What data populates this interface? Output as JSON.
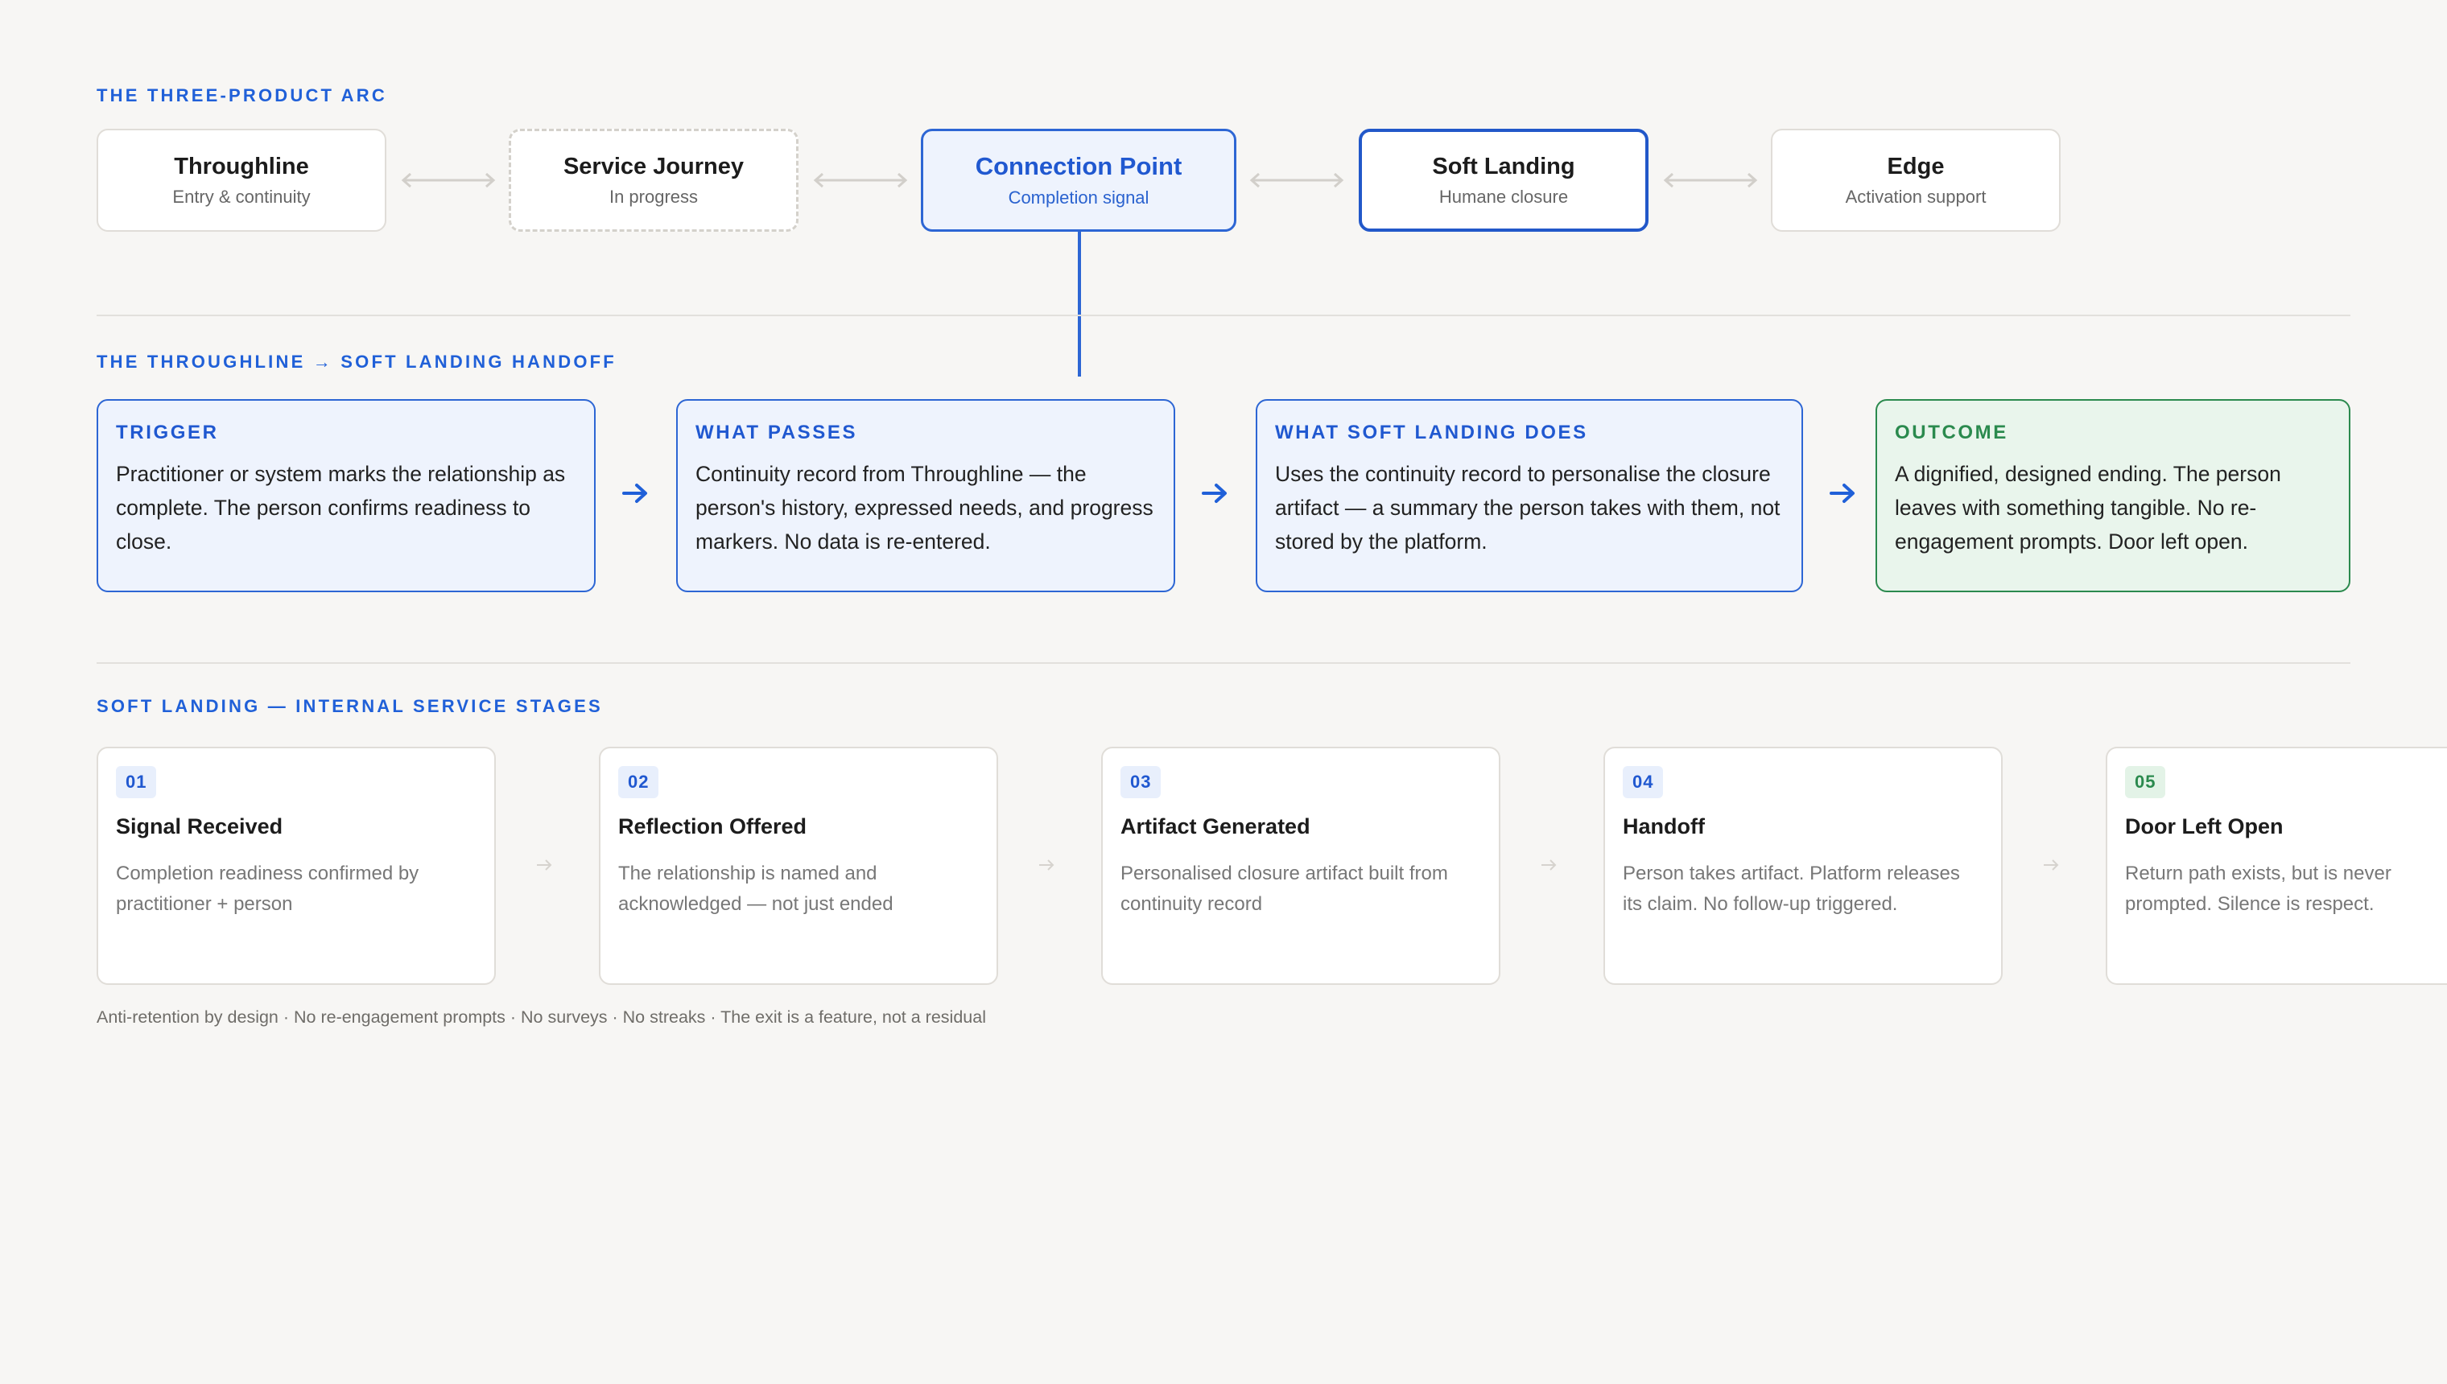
{
  "arc": {
    "label": "THE THREE-PRODUCT ARC",
    "products": [
      {
        "title": "Throughline",
        "subtitle": "Entry & continuity"
      },
      {
        "title": "Service Journey",
        "subtitle": "In progress"
      },
      {
        "title": "Connection Point",
        "subtitle": "Completion signal"
      },
      {
        "title": "Soft Landing",
        "subtitle": "Humane closure"
      },
      {
        "title": "Edge",
        "subtitle": "Activation support"
      }
    ]
  },
  "handoff": {
    "label": "THE THROUGHLINE → SOFT LANDING HANDOFF",
    "steps": [
      {
        "label": "TRIGGER",
        "text": "Practitioner or system marks the relationship as complete. The person confirms readiness to close."
      },
      {
        "label": "WHAT PASSES",
        "text": "Continuity record from Throughline — the person's history, expressed needs, and progress markers. No data is re-entered."
      },
      {
        "label": "WHAT SOFT LANDING DOES",
        "text": "Uses the continuity record to personalise the closure artifact — a summary the person takes with them, not stored by the platform."
      },
      {
        "label": "OUTCOME",
        "text": "A dignified, designed ending. The person leaves with something tangible. No re-engagement prompts. Door left open."
      }
    ]
  },
  "stages": {
    "label": "SOFT LANDING — INTERNAL SERVICE STAGES",
    "items": [
      {
        "num": "01",
        "title": "Signal Received",
        "desc": "Completion readiness confirmed by practitioner + person"
      },
      {
        "num": "02",
        "title": "Reflection Offered",
        "desc": "The relationship is named and acknowledged — not just ended"
      },
      {
        "num": "03",
        "title": "Artifact Generated",
        "desc": "Personalised closure artifact built from continuity record"
      },
      {
        "num": "04",
        "title": "Handoff",
        "desc": "Person takes artifact. Platform releases its claim. No follow-up triggered."
      },
      {
        "num": "05",
        "title": "Door Left Open",
        "desc": "Return path exists, but is never prompted. Silence is respect."
      }
    ]
  },
  "footnote": "Anti-retention by design · No re-engagement prompts · No surveys · No streaks · The exit is a feature, not a residual",
  "colors": {
    "accent": "#2060d8",
    "accent_fill": "#eef3fd",
    "outcome_green": "#2b8a4e",
    "outcome_fill": "#e9f5ec",
    "background": "#f7f6f4"
  },
  "icons": {
    "arc_connector": "double-arrow-icon",
    "handoff_arrow": "arrow-right-icon",
    "stage_arrow": "arrow-right-icon"
  }
}
